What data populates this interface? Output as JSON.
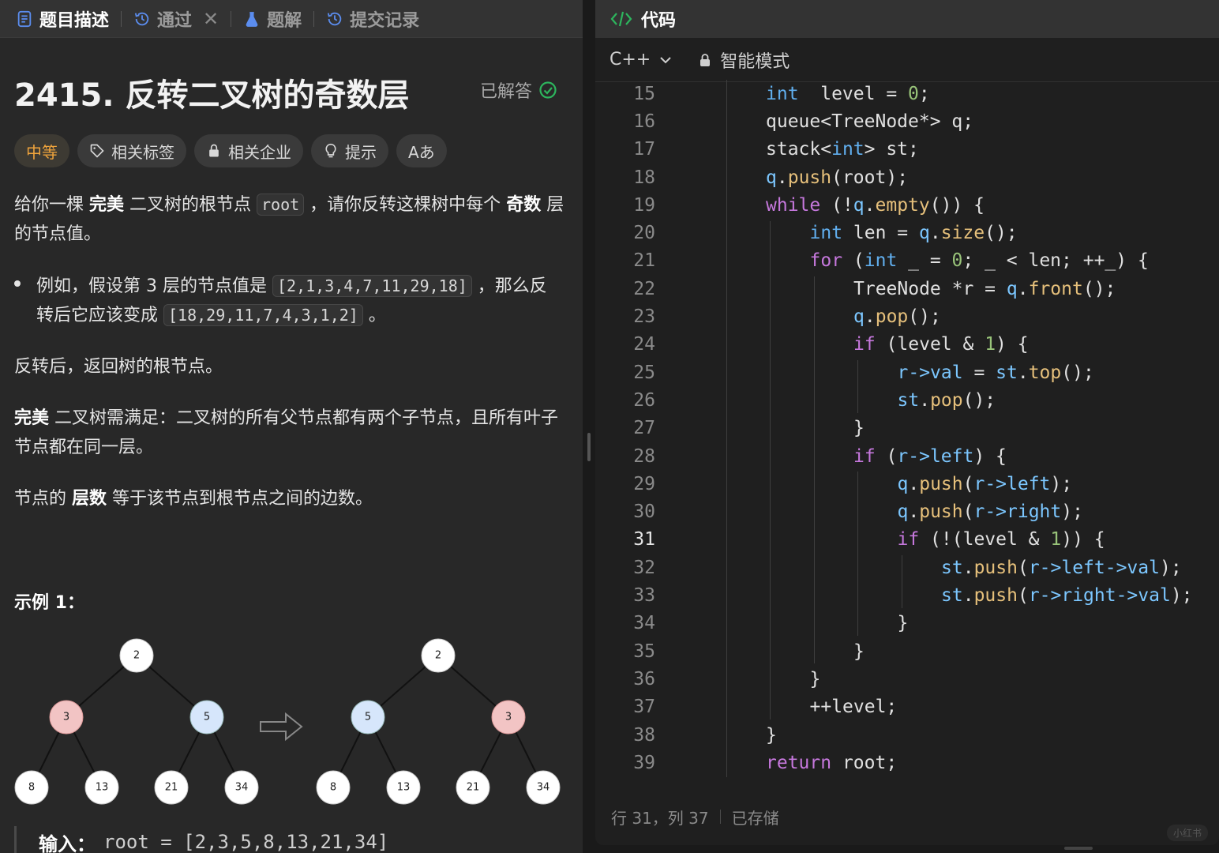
{
  "left_tabs": [
    {
      "label": "题目描述",
      "icon": "description-icon",
      "active": true
    },
    {
      "label": "通过",
      "icon": "history-icon",
      "active": false,
      "closable": true
    },
    {
      "label": "题解",
      "icon": "flask-icon",
      "active": false
    },
    {
      "label": "提交记录",
      "icon": "history-icon",
      "active": false
    }
  ],
  "problem": {
    "title": "2415. 反转二叉树的奇数层",
    "solved_label": "已解答",
    "difficulty": "中等",
    "tags": [
      {
        "label": "相关标签",
        "icon": "tag-icon"
      },
      {
        "label": "相关企业",
        "icon": "lock-icon"
      },
      {
        "label": "提示",
        "icon": "lightbulb-icon"
      },
      {
        "label": "Aあ",
        "icon": "font-icon"
      }
    ],
    "desc_1a": "给你一棵 ",
    "desc_1b": "完美",
    "desc_1c": " 二叉树的根节点 ",
    "desc_1_code": "root",
    "desc_1d": " ，请你反转这棵树中每个 ",
    "desc_1e": "奇数",
    "desc_1f": " 层的节点值。",
    "bullet_a": "例如，假设第 3 层的节点值是 ",
    "bullet_code1": "[2,1,3,4,7,11,29,18]",
    "bullet_b": " ，那么反转后它应该变成 ",
    "bullet_code2": "[18,29,11,7,4,3,1,2]",
    "bullet_c": " 。",
    "desc_2": "反转后，返回树的根节点。",
    "desc_3a": "完美",
    "desc_3b": " 二叉树需满足：二叉树的所有父节点都有两个子节点，且所有叶子节点都在同一层。",
    "desc_4a": "节点的 ",
    "desc_4b": "层数",
    "desc_4c": " 等于该节点到根节点之间的边数。",
    "example_title": "示例 1：",
    "tree_before": {
      "root": "2",
      "level1": [
        "3",
        "5"
      ],
      "level2": [
        "8",
        "13",
        "21",
        "34"
      ]
    },
    "tree_after": {
      "root": "2",
      "level1": [
        "5",
        "3"
      ],
      "level2": [
        "8",
        "13",
        "21",
        "34"
      ]
    },
    "input_label": "输入：",
    "input_value": "root = [2,3,5,8,13,21,34]"
  },
  "editor": {
    "header_title": "代码",
    "language": "C++",
    "mode": "智能模式",
    "lines": [
      {
        "n": "15",
        "indent": 2,
        "tokens": [
          [
            "ty",
            "int"
          ],
          [
            "",
            "  level = "
          ],
          [
            "num",
            "0"
          ],
          [
            "",
            ";"
          ]
        ]
      },
      {
        "n": "16",
        "indent": 2,
        "tokens": [
          [
            "",
            "queue<TreeNode*> q;"
          ]
        ]
      },
      {
        "n": "17",
        "indent": 2,
        "tokens": [
          [
            "",
            "stack<"
          ],
          [
            "ty",
            "int"
          ],
          [
            "",
            "> st;"
          ]
        ]
      },
      {
        "n": "18",
        "indent": 2,
        "tokens": [
          [
            "var",
            "q"
          ],
          [
            "",
            "."
          ],
          [
            "fn",
            "push"
          ],
          [
            "",
            "(root);"
          ]
        ]
      },
      {
        "n": "19",
        "indent": 2,
        "tokens": [
          [
            "kw",
            "while"
          ],
          [
            "",
            " (!"
          ],
          [
            "var",
            "q"
          ],
          [
            "",
            "."
          ],
          [
            "fn",
            "empty"
          ],
          [
            "",
            "()) {"
          ]
        ]
      },
      {
        "n": "20",
        "indent": 3,
        "tokens": [
          [
            "ty",
            "int"
          ],
          [
            "",
            " len = "
          ],
          [
            "var",
            "q"
          ],
          [
            "",
            "."
          ],
          [
            "fn",
            "size"
          ],
          [
            "",
            "();"
          ]
        ]
      },
      {
        "n": "21",
        "indent": 3,
        "tokens": [
          [
            "kw",
            "for"
          ],
          [
            "",
            " ("
          ],
          [
            "ty",
            "int"
          ],
          [
            "",
            " _ = "
          ],
          [
            "num",
            "0"
          ],
          [
            "",
            "; _ < len; ++_) {"
          ]
        ]
      },
      {
        "n": "22",
        "indent": 4,
        "tokens": [
          [
            "",
            "TreeNode *r = "
          ],
          [
            "var",
            "q"
          ],
          [
            "",
            "."
          ],
          [
            "fn",
            "front"
          ],
          [
            "",
            "();"
          ]
        ]
      },
      {
        "n": "23",
        "indent": 4,
        "tokens": [
          [
            "var",
            "q"
          ],
          [
            "",
            "."
          ],
          [
            "fn",
            "pop"
          ],
          [
            "",
            "();"
          ]
        ]
      },
      {
        "n": "24",
        "indent": 4,
        "tokens": [
          [
            "kw",
            "if"
          ],
          [
            "",
            " (level & "
          ],
          [
            "num",
            "1"
          ],
          [
            "",
            ") {"
          ]
        ]
      },
      {
        "n": "25",
        "indent": 5,
        "tokens": [
          [
            "var",
            "r->val"
          ],
          [
            "",
            " = "
          ],
          [
            "var",
            "st"
          ],
          [
            "",
            "."
          ],
          [
            "fn",
            "top"
          ],
          [
            "",
            "();"
          ]
        ]
      },
      {
        "n": "26",
        "indent": 5,
        "tokens": [
          [
            "var",
            "st"
          ],
          [
            "",
            "."
          ],
          [
            "fn",
            "pop"
          ],
          [
            "",
            "();"
          ]
        ]
      },
      {
        "n": "27",
        "indent": 4,
        "tokens": [
          [
            "",
            "}"
          ]
        ]
      },
      {
        "n": "28",
        "indent": 4,
        "tokens": [
          [
            "kw",
            "if"
          ],
          [
            "",
            " ("
          ],
          [
            "var",
            "r->left"
          ],
          [
            "",
            ") {"
          ]
        ]
      },
      {
        "n": "29",
        "indent": 5,
        "tokens": [
          [
            "var",
            "q"
          ],
          [
            "",
            "."
          ],
          [
            "fn",
            "push"
          ],
          [
            "",
            "("
          ],
          [
            "var",
            "r->left"
          ],
          [
            "",
            ");"
          ]
        ]
      },
      {
        "n": "30",
        "indent": 5,
        "tokens": [
          [
            "var",
            "q"
          ],
          [
            "",
            "."
          ],
          [
            "fn",
            "push"
          ],
          [
            "",
            "("
          ],
          [
            "var",
            "r->right"
          ],
          [
            "",
            ");"
          ]
        ]
      },
      {
        "n": "31",
        "indent": 5,
        "tokens": [
          [
            "kw",
            "if"
          ],
          [
            "",
            " (!(level & "
          ],
          [
            "num",
            "1"
          ],
          [
            "",
            ")) {"
          ]
        ]
      },
      {
        "n": "32",
        "indent": 6,
        "tokens": [
          [
            "var",
            "st"
          ],
          [
            "",
            "."
          ],
          [
            "fn",
            "push"
          ],
          [
            "",
            "("
          ],
          [
            "var",
            "r->left->val"
          ],
          [
            "",
            ");"
          ]
        ]
      },
      {
        "n": "33",
        "indent": 6,
        "tokens": [
          [
            "var",
            "st"
          ],
          [
            "",
            "."
          ],
          [
            "fn",
            "push"
          ],
          [
            "",
            "("
          ],
          [
            "var",
            "r->right->val"
          ],
          [
            "",
            ");"
          ]
        ]
      },
      {
        "n": "34",
        "indent": 5,
        "tokens": [
          [
            "",
            "}"
          ]
        ]
      },
      {
        "n": "35",
        "indent": 4,
        "tokens": [
          [
            "",
            "}"
          ]
        ]
      },
      {
        "n": "36",
        "indent": 3,
        "tokens": [
          [
            "",
            "}"
          ]
        ]
      },
      {
        "n": "37",
        "indent": 3,
        "tokens": [
          [
            "",
            "++level;"
          ]
        ]
      },
      {
        "n": "38",
        "indent": 2,
        "tokens": [
          [
            "",
            "}"
          ]
        ]
      },
      {
        "n": "39",
        "indent": 2,
        "tokens": [
          [
            "kw",
            "return"
          ],
          [
            "",
            " root;"
          ]
        ]
      }
    ],
    "current_line": "31",
    "status_position": "行 31，列 37",
    "status_saved": "已存储",
    "watermark": "小红书"
  },
  "colors": {
    "keyword": "#c678dd",
    "type": "#61afef",
    "function": "#e6c07b",
    "number": "#98c379",
    "node_red": "#f2c4c4",
    "node_blue": "#d6e6fb",
    "difficulty": "#f0a43c",
    "solved_check": "#2db55d"
  }
}
